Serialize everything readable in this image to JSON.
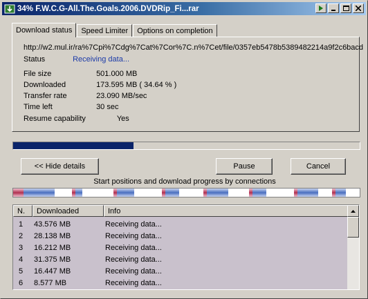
{
  "window": {
    "title": "34% F.W.C.G-All.The.Goals.2006.DVDRip_Fi...rar"
  },
  "tabs": [
    "Download status",
    "Speed Limiter",
    "Options on completion"
  ],
  "status": {
    "url": "http://w2.mul.ir/ra%7Cpi%7Cdg%7Cat%7Cor%7C.n%7Cet/file/0357eb5478b5389482214a9f2c6bacd",
    "status_label": "Status",
    "status_value": "Receiving data...",
    "file_size_label": "File size",
    "file_size_value": "501.000  MB",
    "downloaded_label": "Downloaded",
    "downloaded_value": "173.595  MB  ( 34.64 % )",
    "transfer_label": "Transfer rate",
    "transfer_value": "23.090  MB/sec",
    "time_left_label": "Time left",
    "time_left_value": "30 sec",
    "resume_label": "Resume capability",
    "resume_value": "Yes"
  },
  "progress": {
    "fraction": 0.3464
  },
  "buttons": {
    "hide_details": "<< Hide details",
    "pause": "Pause",
    "cancel": "Cancel"
  },
  "connections_label": "Start positions and download progress by connections",
  "connection_bar": [
    {
      "w": 0.03,
      "c": "#c04060"
    },
    {
      "w": 0.09,
      "c": "#4a6fc0"
    },
    {
      "w": 0.05,
      "c": "#ffffff"
    },
    {
      "w": 0.01,
      "c": "#c04060"
    },
    {
      "w": 0.02,
      "c": "#4a6fc0"
    },
    {
      "w": 0.09,
      "c": "#ffffff"
    },
    {
      "w": 0.01,
      "c": "#c04060"
    },
    {
      "w": 0.05,
      "c": "#4a6fc0"
    },
    {
      "w": 0.08,
      "c": "#ffffff"
    },
    {
      "w": 0.01,
      "c": "#c04060"
    },
    {
      "w": 0.04,
      "c": "#4a6fc0"
    },
    {
      "w": 0.07,
      "c": "#ffffff"
    },
    {
      "w": 0.01,
      "c": "#c04060"
    },
    {
      "w": 0.06,
      "c": "#4a6fc0"
    },
    {
      "w": 0.06,
      "c": "#ffffff"
    },
    {
      "w": 0.01,
      "c": "#c04060"
    },
    {
      "w": 0.04,
      "c": "#4a6fc0"
    },
    {
      "w": 0.08,
      "c": "#ffffff"
    },
    {
      "w": 0.01,
      "c": "#c04060"
    },
    {
      "w": 0.06,
      "c": "#4a6fc0"
    },
    {
      "w": 0.04,
      "c": "#ffffff"
    },
    {
      "w": 0.01,
      "c": "#c04060"
    },
    {
      "w": 0.03,
      "c": "#4a6fc0"
    },
    {
      "w": 0.04,
      "c": "#ffffff"
    }
  ],
  "table": {
    "headers": [
      "N.",
      "Downloaded",
      "Info"
    ],
    "rows": [
      [
        "1",
        "43.576  MB",
        "Receiving data..."
      ],
      [
        "2",
        "28.138  MB",
        "Receiving data..."
      ],
      [
        "3",
        "16.212  MB",
        "Receiving data..."
      ],
      [
        "4",
        "31.375  MB",
        "Receiving data..."
      ],
      [
        "5",
        "16.447  MB",
        "Receiving data..."
      ],
      [
        "6",
        "8.577  MB",
        "Receiving data..."
      ]
    ]
  }
}
